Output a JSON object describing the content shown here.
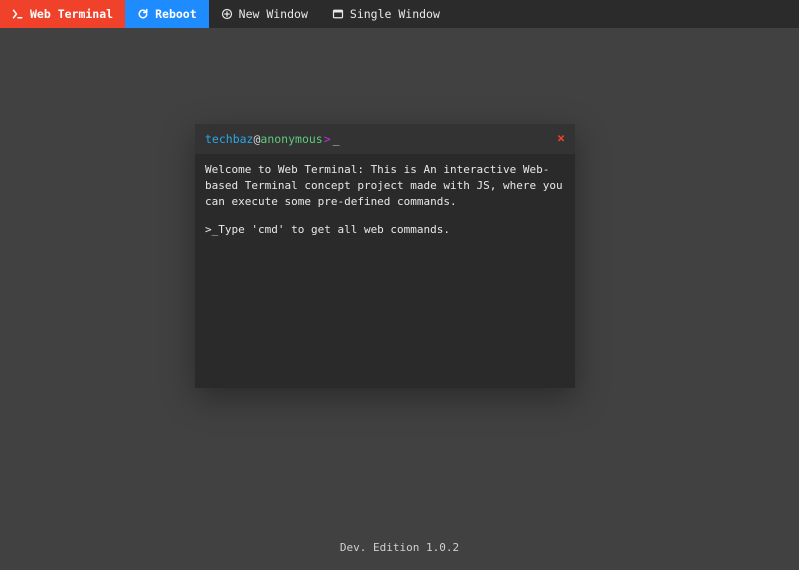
{
  "topbar": {
    "brand": "Web Terminal",
    "reboot": "Reboot",
    "new_window": "New Window",
    "single_window": "Single Window"
  },
  "terminal": {
    "prompt_user": "techbaz",
    "prompt_at": "@",
    "prompt_host": "anonymous",
    "prompt_gt": ">",
    "cursor": "_",
    "close": "×",
    "welcome": "Welcome to Web Terminal:  This is An interactive Web-based Terminal concept project made with JS, where you can execute some pre-defined commands.",
    "hint": ">_Type 'cmd' to get all web commands."
  },
  "footer": {
    "version": "Dev. Edition 1.0.2"
  }
}
